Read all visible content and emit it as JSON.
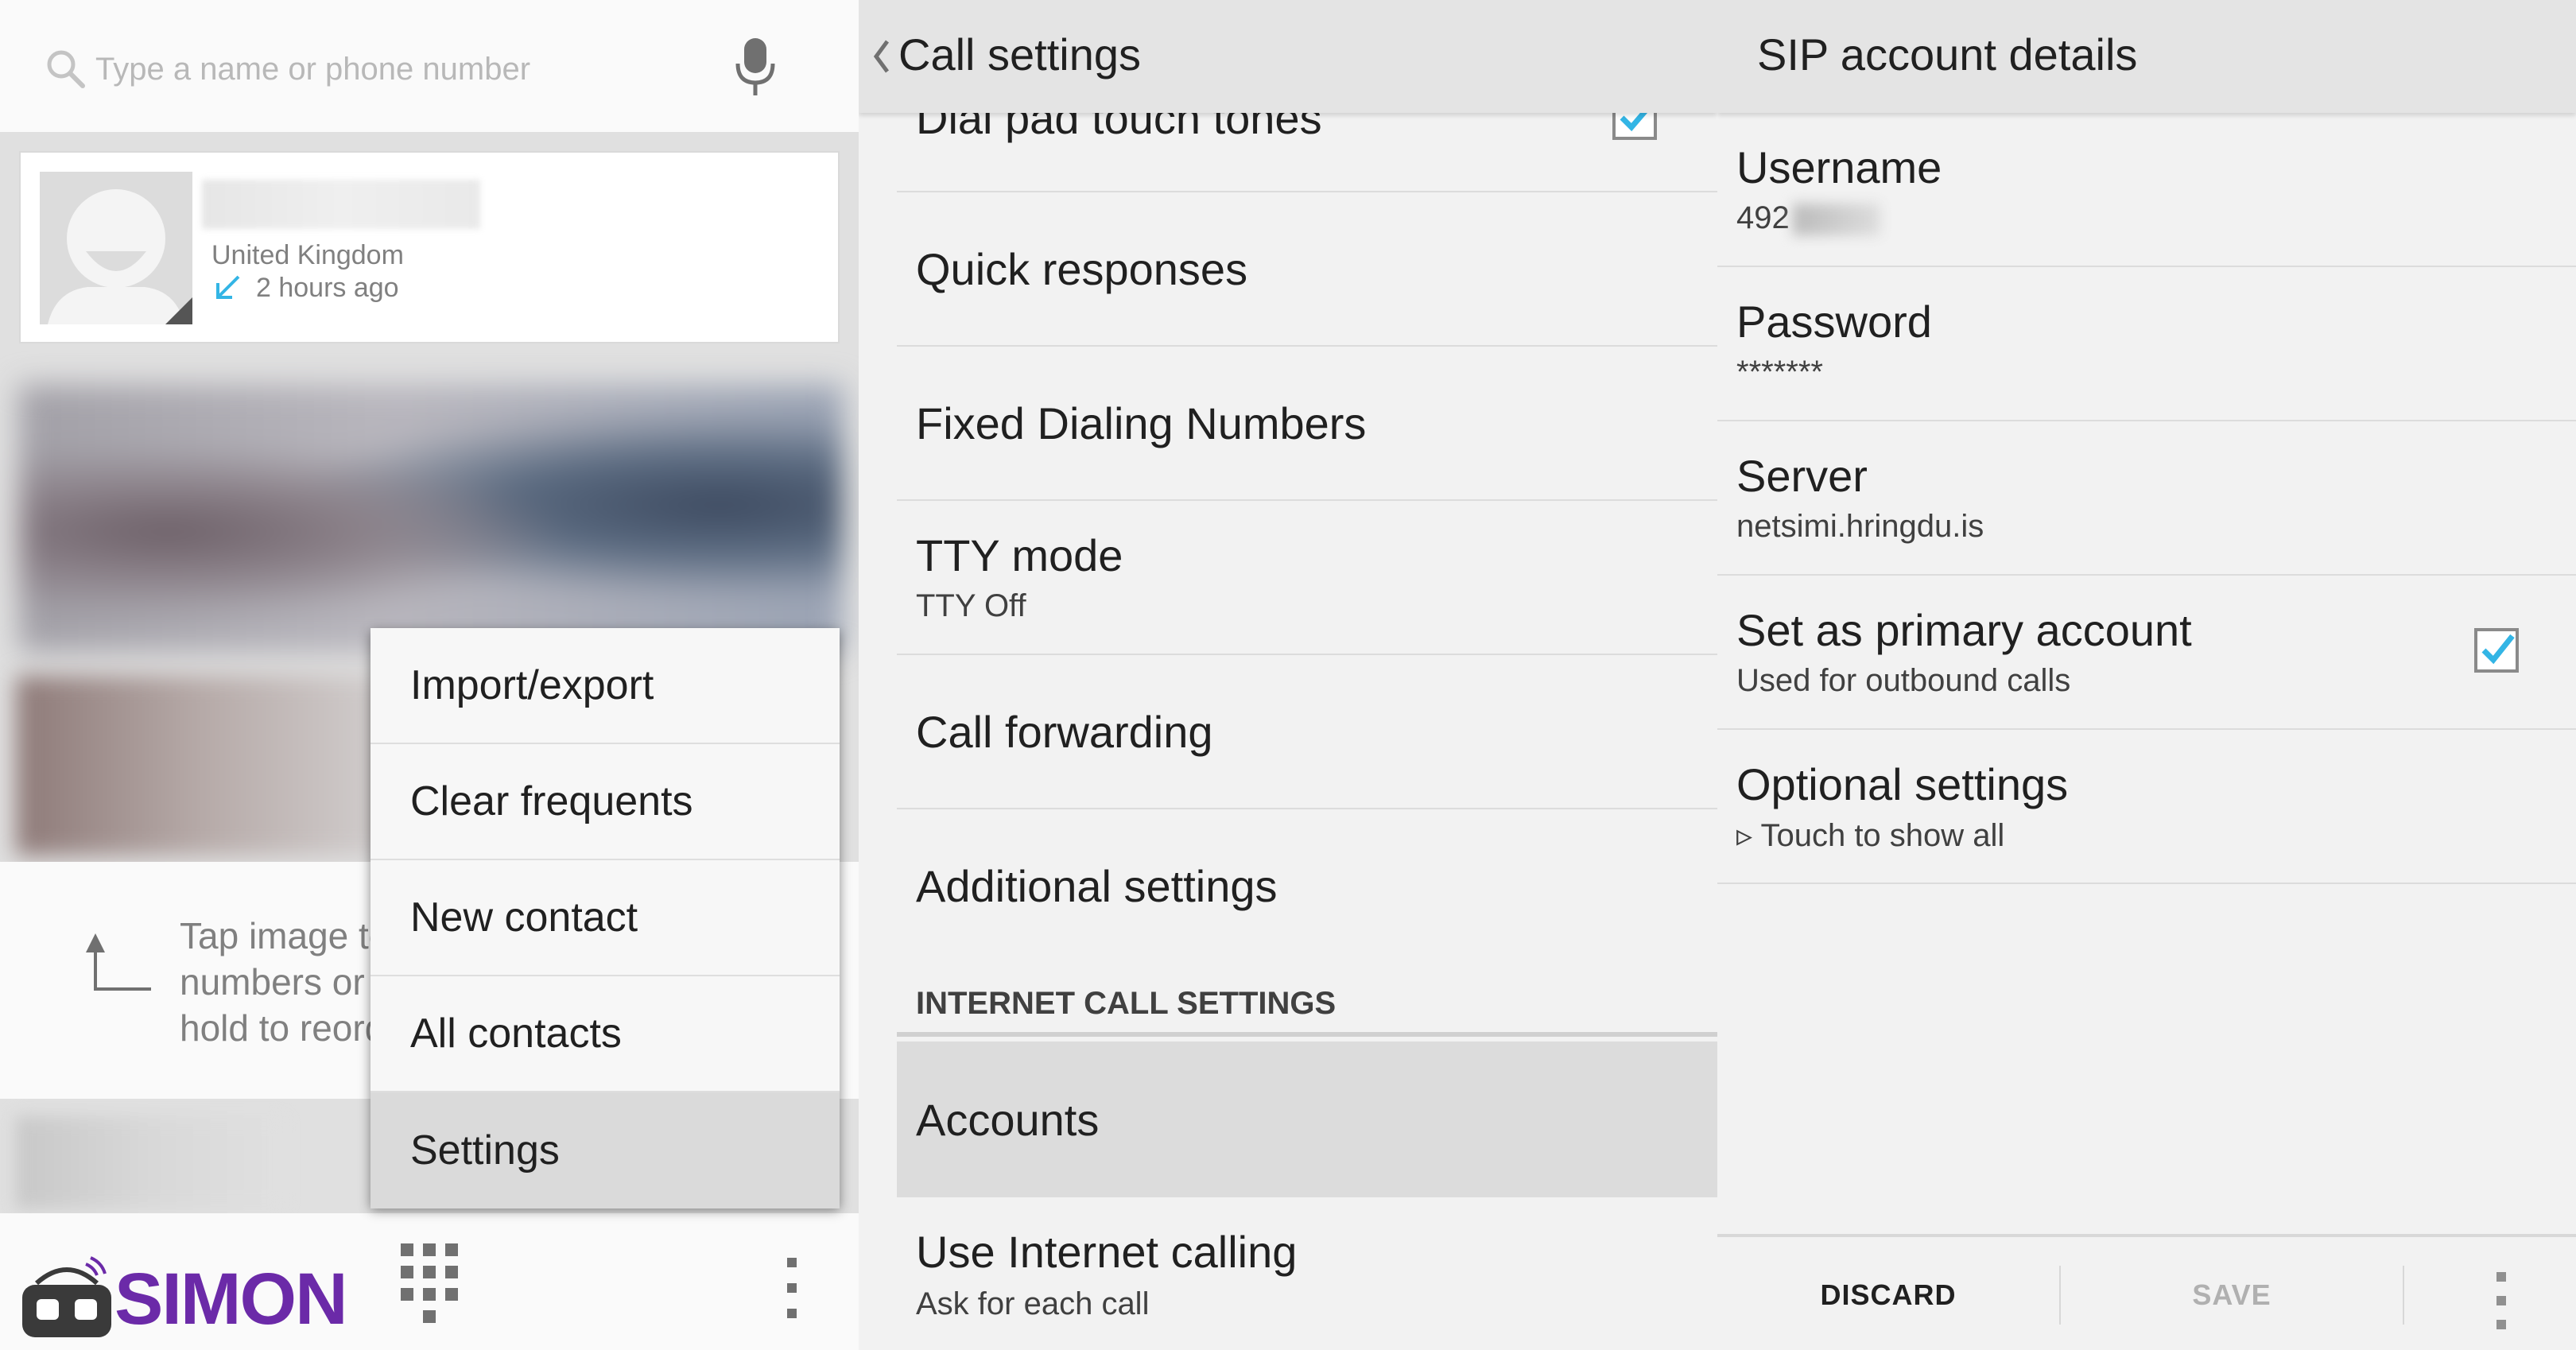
{
  "dialer": {
    "search_placeholder": "Type a name or phone number",
    "recent": {
      "location": "United Kingdom",
      "time": "2 hours ago"
    },
    "hint": "Tap image to see numbers or\nhold to reorder",
    "logo_text": "SIMON",
    "menu": [
      "Import/export",
      "Clear frequents",
      "New contact",
      "All contacts",
      "Settings"
    ],
    "menu_highlighted": "Settings"
  },
  "call_settings": {
    "title": "Call settings",
    "items": [
      {
        "title": "Dial pad touch tones",
        "checked": true
      },
      {
        "title": "Quick responses"
      },
      {
        "title": "Fixed Dialing Numbers"
      },
      {
        "title": "TTY mode",
        "subtitle": "TTY Off"
      },
      {
        "title": "Call forwarding"
      },
      {
        "title": "Additional settings"
      }
    ],
    "section_header": "INTERNET CALL SETTINGS",
    "accounts": "Accounts",
    "use_internet_calling": {
      "title": "Use Internet calling",
      "subtitle": "Ask for each call"
    }
  },
  "sip_account": {
    "title": "SIP account details",
    "username_label": "Username",
    "username_value": "492",
    "password_label": "Password",
    "password_value": "*******",
    "server_label": "Server",
    "server_value": "netsimi.hringdu.is",
    "primary_label": "Set as primary account",
    "primary_sub": "Used for outbound calls",
    "primary_checked": true,
    "optional_label": "Optional settings",
    "optional_sub": "▹ Touch to show all",
    "discard": "DISCARD",
    "save": "SAVE"
  },
  "colors": {
    "accent": "#33b5e5",
    "logo": "#6b2aa8",
    "incoming_arrow": "#33b5e5"
  }
}
